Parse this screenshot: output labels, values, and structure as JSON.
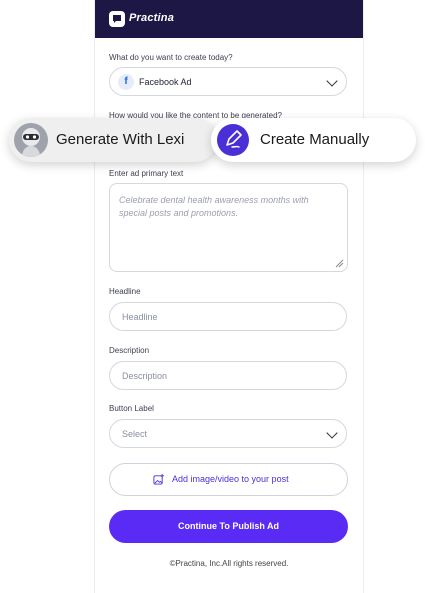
{
  "brand": {
    "name": "Practina"
  },
  "form": {
    "create_label": "What do you want to create today?",
    "create_value": "Facebook Ad",
    "content_label": "How would you like the content to be generated?",
    "primary_text_label": "Enter ad primary text",
    "primary_text_placeholder": "Celebrate dental health awareness months with special posts and promotions.",
    "headline_label": "Headline",
    "headline_placeholder": "Headline",
    "description_label": "Description",
    "description_placeholder": "Description",
    "button_label_label": "Button Label",
    "button_label_value": "Select",
    "add_media_label": "Add image/video to your post",
    "continue_label": "Continue To Publish Ad"
  },
  "options": {
    "generate_label": "Generate With Lexi",
    "manual_label": "Create Manually"
  },
  "footer": {
    "copyright": "©Practina, Inc.All rights reserved."
  },
  "colors": {
    "topbar": "#1c1745",
    "primary": "#5a2bf5",
    "accent": "#4b2fd6"
  },
  "icons": [
    "practina-logo-icon",
    "facebook-icon",
    "chevron-down-icon",
    "lexi-avatar-icon",
    "pen-icon",
    "image-add-icon",
    "resize-handle-icon"
  ]
}
